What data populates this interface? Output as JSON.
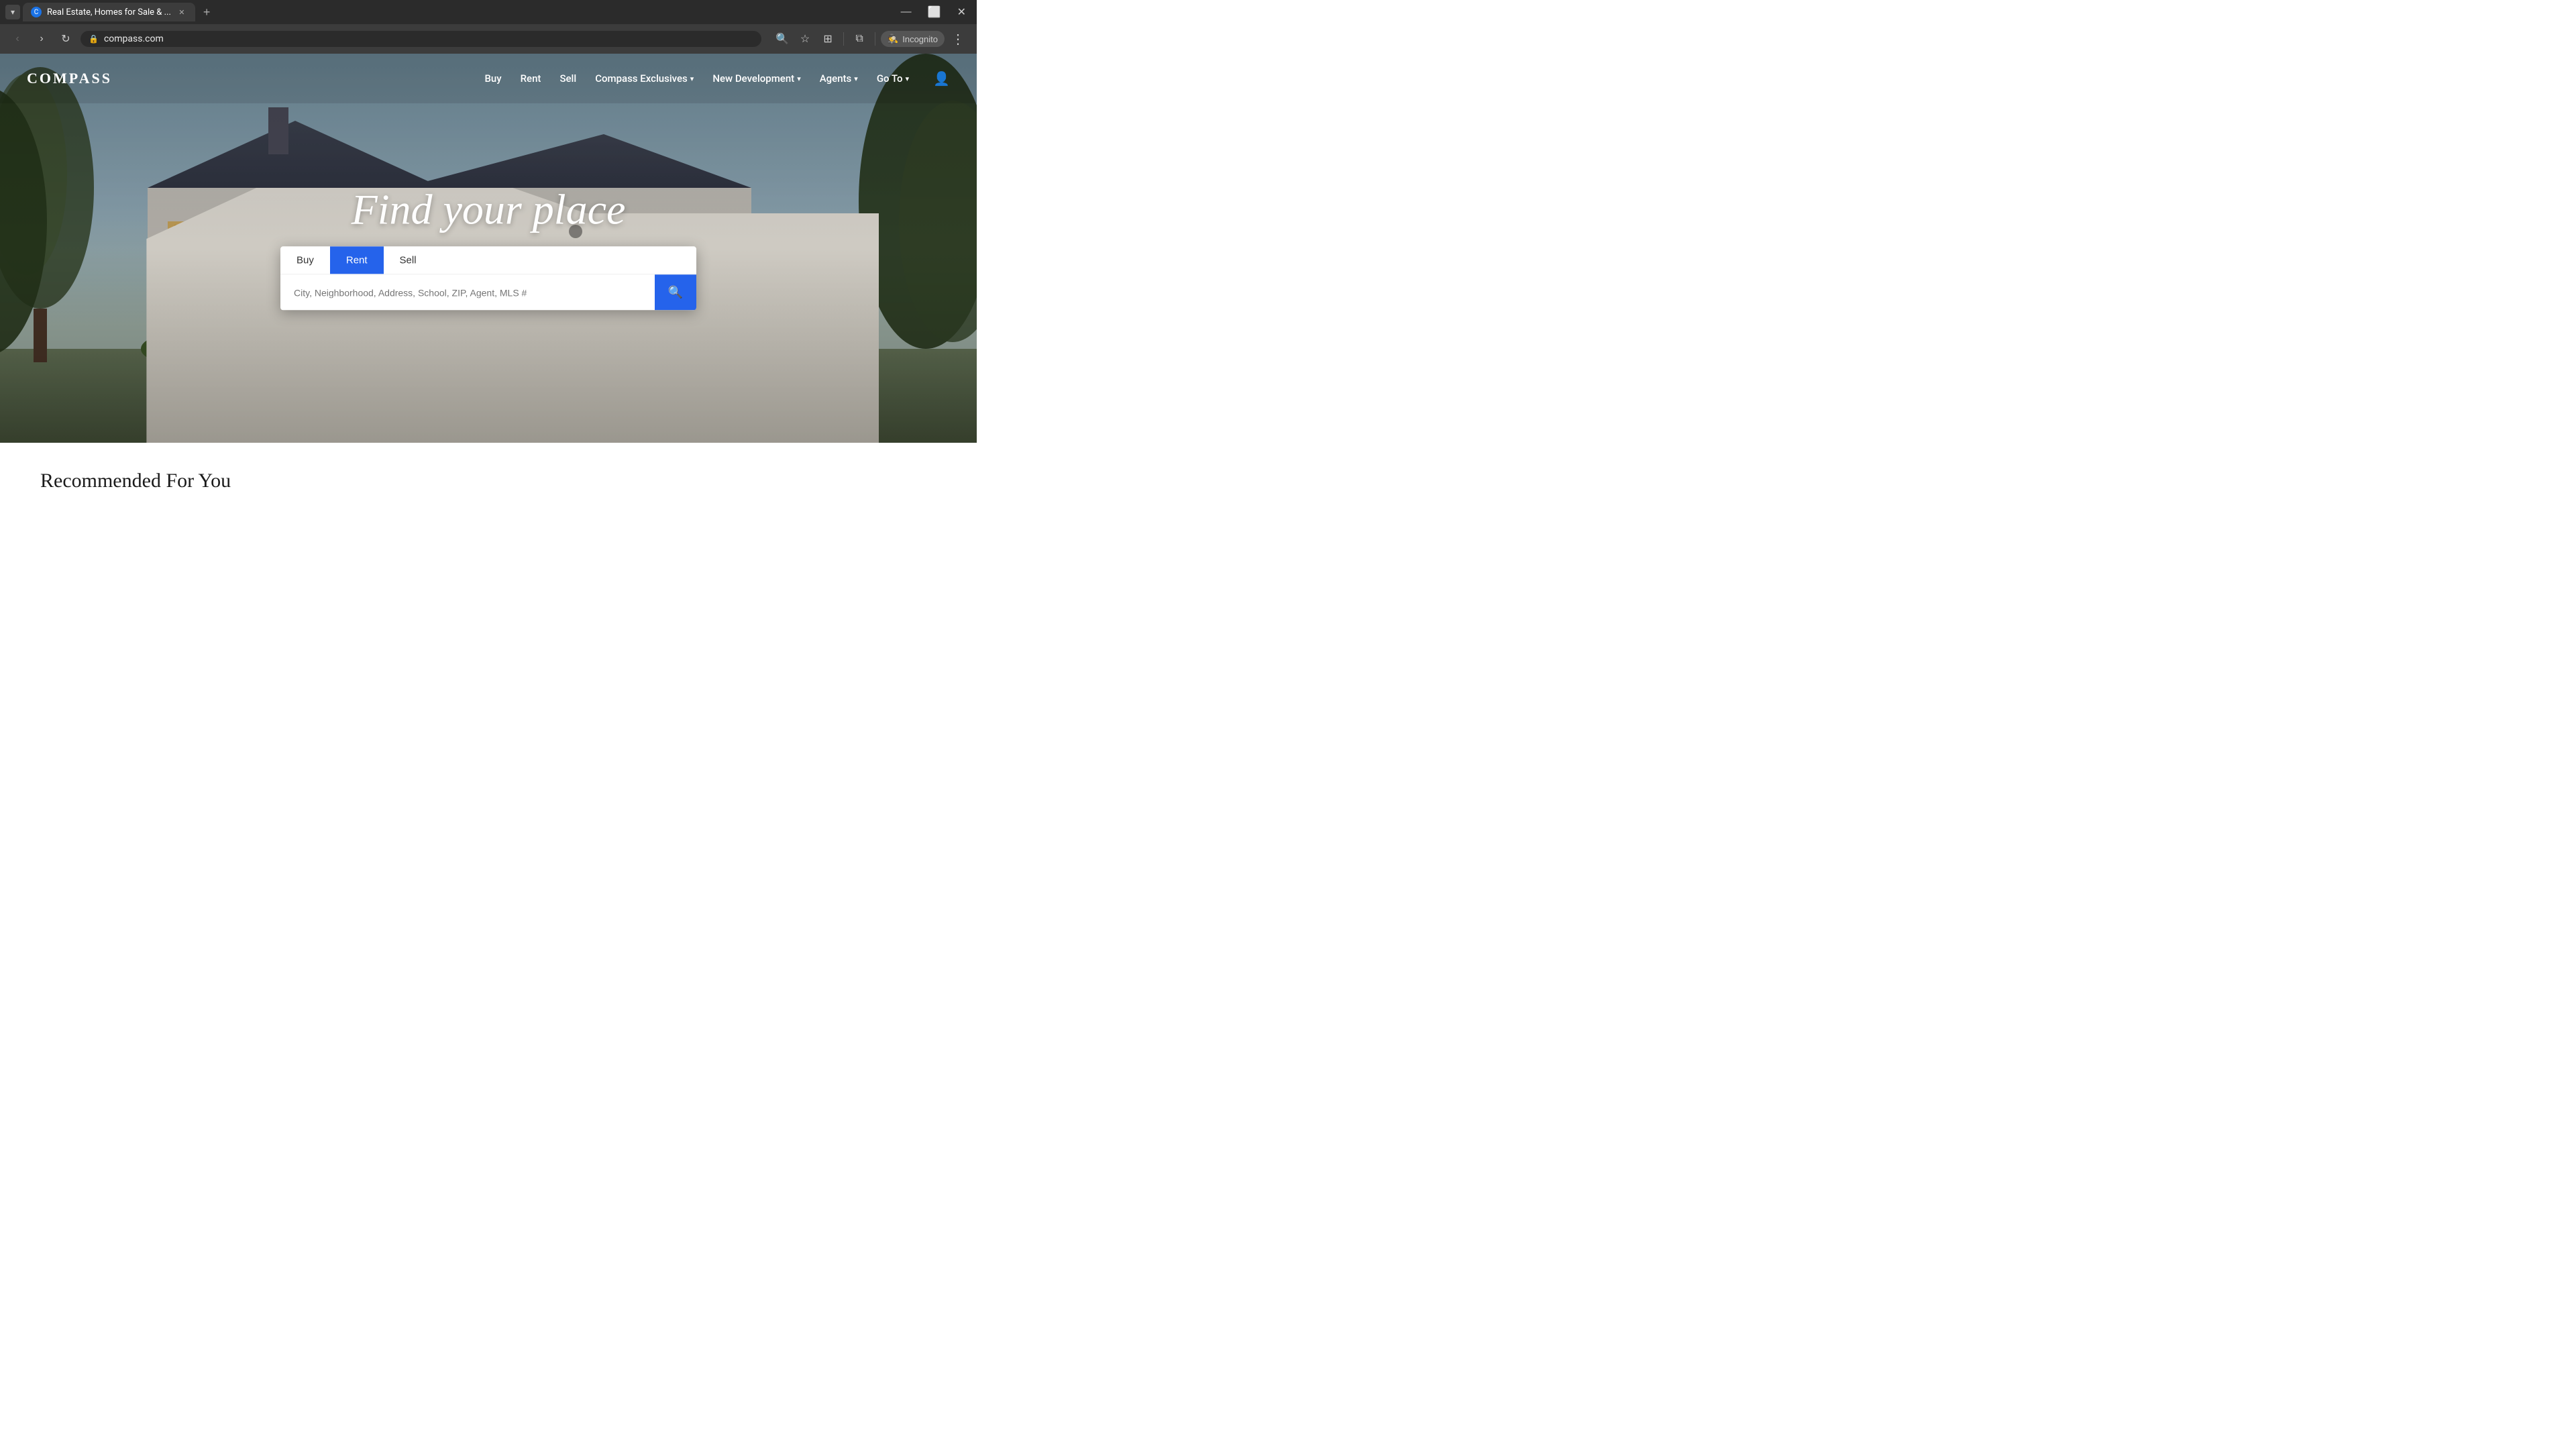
{
  "browser": {
    "tab_title": "Real Estate, Homes for Sale & ...",
    "url": "compass.com",
    "tab_favicon": "C",
    "incognito_label": "Incognito",
    "new_tab_icon": "+"
  },
  "site": {
    "logo": "COMPASS",
    "nav": {
      "buy": "Buy",
      "rent": "Rent",
      "sell": "Sell",
      "compass_exclusives": "Compass Exclusives",
      "new_development": "New Development",
      "agents": "Agents",
      "goto": "Go To"
    }
  },
  "hero": {
    "title": "Find your place",
    "search": {
      "tab_buy": "Buy",
      "tab_rent": "Rent",
      "tab_sell": "Sell",
      "placeholder": "City, Neighborhood, Address, School, ZIP, Agent, MLS #",
      "active_tab": "rent"
    }
  },
  "recommended": {
    "section_title": "Recommended For You"
  },
  "icons": {
    "back": "‹",
    "forward": "›",
    "refresh": "↻",
    "search": "🔍",
    "bookmark": "☆",
    "extensions": "⊞",
    "profile": "◯",
    "menu": "⋮",
    "window_minimize": "—",
    "window_maximize": "⬜",
    "window_close": "✕",
    "tab_dropdown": "▾",
    "chevron_down": "▾",
    "user": "👤",
    "magnifier": "🔍"
  }
}
